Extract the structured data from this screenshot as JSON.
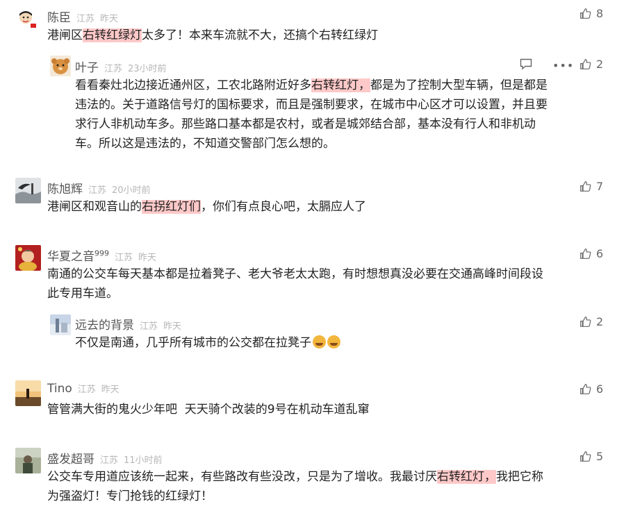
{
  "comments": [
    {
      "name": "陈臣",
      "location": "江苏",
      "time": "昨天",
      "likes": "8",
      "text_parts": [
        "港闸区",
        "右转红绿灯",
        "太多了！本来车流就不大，还搞个右转红绿灯"
      ]
    },
    {
      "name": "叶子",
      "location": "江苏",
      "time": "23小时前",
      "likes": "2",
      "text_lines": [
        [
          "看看秦灶北边接近通州区，工农北路附近好多",
          "右转红灯，",
          "都是为了控制大型车辆，但是都是"
        ],
        "违法的。关于道路信号灯的国标要求，而且是强制要求，在城市中心区才可以设置，并且要",
        "求行人非机动车多。那些路口基本都是农村，或者是城郊结合部，基本没有行人和非机动",
        "车。所以这是违法的，不知道交警部门怎么想的。"
      ]
    },
    {
      "name": "陈旭辉",
      "location": "江苏",
      "time": "20小时前",
      "likes": "7",
      "text_parts": [
        "港闸区和观音山的",
        "右拐红灯们",
        "，你们有点良心吧，太膈应人了"
      ]
    },
    {
      "name": "华夏之音",
      "name_sup": "999",
      "location": "江苏",
      "time": "昨天",
      "likes": "6",
      "text_lines": [
        "南通的公交车每天基本都是拉着凳子、老大爷老太太跑，有时想想真没必要在交通高峰时间段设",
        "此专用车道。"
      ]
    },
    {
      "name": "远去的背景",
      "location": "江苏",
      "time": "昨天",
      "likes": "2",
      "text": "不仅是南通，几乎所有城市的公交都在拉凳子"
    },
    {
      "name": "Tino",
      "location": "江苏",
      "time": "昨天",
      "likes": "6",
      "text": "管管满大街的鬼火少年吧  天天骑个改装的9号在机动车道乱窜"
    },
    {
      "name": "盛发超哥",
      "location": "江苏",
      "time": "11小时前",
      "likes": "5",
      "text_lines": [
        [
          "公交车专用道应该统一起来，有些路改有些没改，只是为了增收。我最讨厌",
          "右转红灯，",
          "我把它称"
        ],
        "为强盗灯！专门抢钱的红绿灯！"
      ]
    }
  ]
}
